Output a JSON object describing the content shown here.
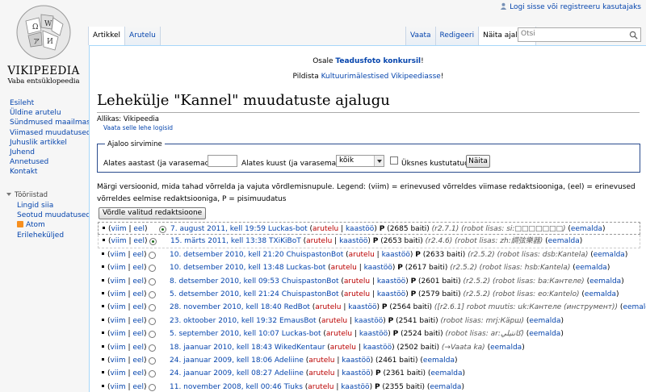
{
  "logo": {
    "wordmark": "Vikipeedia",
    "tagline": "Vaba entsüklopeedia"
  },
  "personal": {
    "login_label": "Logi sisse või registreeru kasutajaks"
  },
  "tabs": {
    "article": "Artikkel",
    "talk": "Arutelu",
    "view": "Vaata",
    "edit": "Redigeeri",
    "history": "Näita ajalugu"
  },
  "search": {
    "placeholder": "Otsi"
  },
  "sidebar": {
    "items": [
      "Esileht",
      "Üldine arutelu",
      "Sündmused maailmas",
      "Viimased muudatused",
      "Juhuslik artikkel",
      "Juhend",
      "Annetused",
      "Kontakt"
    ],
    "toolbox_label": "Tööriistad",
    "tools": [
      "Lingid siia",
      "Seotud muudatused",
      "Atom",
      "Erileheküljed"
    ]
  },
  "notices": {
    "line1_prefix": "Osale ",
    "line1_link": "Teadusfoto konkursil",
    "line1_suffix": "!",
    "line2_prefix": "Pildista ",
    "line2_link": "Kultuurimälestised Vikipeediasse",
    "line2_suffix": "!"
  },
  "page": {
    "title": "Lehekülje \"Kannel\" muudatuste ajalugu",
    "source": "Allikas: Vikipeedia",
    "logs_link": "Vaata selle lehe logisid"
  },
  "filter": {
    "legend": "Ajaloo sirvimine",
    "year_label": "Alates aastast (ja varasemad):",
    "month_label": "Alates kuust (ja varasemad):",
    "month_value": "kõik",
    "tags_label": "Üksnes kustutatud",
    "go_label": "Näita"
  },
  "legend_text": "Märgi versioonid, mida tahad võrrelda ja vajuta võrdlemisnupule. Legend: (viim) = erinevused võrreldes viimase redaktsiooniga, (eel) = erinevused võrreldes eelmise redaktsiooniga, P = pisimuudatus",
  "compare_label": "Võrdle valitud redaktsioone",
  "history_rows": [
    {
      "cur": "viim",
      "prev": "eel",
      "date": "7. august 2011, kell 19:59",
      "user": "Luckas-bot",
      "minor": "P",
      "size": "(2685 baiti)",
      "summary": "(r2.7.1) (robot lisas: si:□□□□□□□)",
      "undo": "eemalda",
      "radio1": false,
      "radio1_checked": true,
      "radio2": false
    },
    {
      "cur": "viim",
      "prev": "eel",
      "date": "15. märts 2011, kell 13:38",
      "user": "TXiKiBoT",
      "minor": "P",
      "size": "(2653 baiti)",
      "summary": "(r2.4.6) (robot lisas: zh:調弦樂器)",
      "undo": "eemalda",
      "radio1": false,
      "radio2": true,
      "radio2_checked": true
    },
    {
      "cur": "viim",
      "prev": "eel",
      "date": "10. detsember 2010, kell 21:20",
      "user": "ChuispastonBot",
      "minor": "P",
      "size": "(2633 baiti)",
      "summary": "(r2.5.2) (robot lisas: dsb:Kantela)",
      "undo": "eemalda",
      "radio2": true
    },
    {
      "cur": "viim",
      "prev": "eel",
      "date": "10. detsember 2010, kell 13:48",
      "user": "Luckas-bot",
      "minor": "P",
      "size": "(2617 baiti)",
      "summary": "(r2.5.2) (robot lisas: hsb:Kantela)",
      "undo": "eemalda",
      "radio2": true
    },
    {
      "cur": "viim",
      "prev": "eel",
      "date": "8. detsember 2010, kell 09:53",
      "user": "ChuispastonBot",
      "minor": "P",
      "size": "(2601 baiti)",
      "summary": "(r2.5.2) (robot lisas: ba:Кантеле)",
      "undo": "eemalda",
      "radio2": true
    },
    {
      "cur": "viim",
      "prev": "eel",
      "date": "5. detsember 2010, kell 21:24",
      "user": "ChuispastonBot",
      "minor": "P",
      "size": "(2579 baiti)",
      "summary": "(r2.5.2) (robot lisas: eo:Kantelo)",
      "undo": "eemalda",
      "radio2": true
    },
    {
      "cur": "viim",
      "prev": "eel",
      "date": "28. november 2010, kell 18:40",
      "user": "RedBot",
      "minor": "P",
      "size": "(2564 baiti)",
      "summary": "([r2.6.1] robot muutis: uk:Кантеле (инструмент))",
      "undo": "eemalda",
      "radio2": true
    },
    {
      "cur": "viim",
      "prev": "eel",
      "date": "23. oktoober 2010, kell 19:32",
      "user": "EmausBot",
      "minor": "P",
      "size": "(2541 baiti)",
      "summary": "(robot lisas: mrj:Кäрш)",
      "undo": "eemalda",
      "radio2": true
    },
    {
      "cur": "viim",
      "prev": "eel",
      "date": "5. september 2010, kell 10:07",
      "user": "Luckas-bot",
      "minor": "P",
      "size": "(2524 baiti)",
      "summary": "(robot lisas: ar:كانتيلي)",
      "undo": "eemalda",
      "radio2": true
    },
    {
      "cur": "viim",
      "prev": "eel",
      "date": "18. jaanuar 2010, kell 18:43",
      "user": "WikedKentaur",
      "minor": "",
      "size": "(2502 baiti)",
      "summary": "(→Vaata ka)",
      "undo": "eemalda",
      "radio2": true
    },
    {
      "cur": "viim",
      "prev": "eel",
      "date": "24. jaanuar 2009, kell 18:06",
      "user": "Adeliine",
      "minor": "",
      "size": "(2461 baiti)",
      "summary": "",
      "undo": "eemalda",
      "radio2": true
    },
    {
      "cur": "viim",
      "prev": "eel",
      "date": "24. jaanuar 2009, kell 08:27",
      "user": "Adeliine",
      "minor": "P",
      "size": "(2361 baiti)",
      "summary": "",
      "undo": "eemalda",
      "radio2": true
    },
    {
      "cur": "viim",
      "prev": "eel",
      "date": "11. november 2008, kell 00:46",
      "user": "Tiuks",
      "minor": "P",
      "size": "(2355 baiti)",
      "summary": "",
      "undo": "eemalda",
      "radio2": true
    }
  ],
  "row_labels": {
    "talk": "arutelu",
    "contribs": "kaastöö"
  }
}
